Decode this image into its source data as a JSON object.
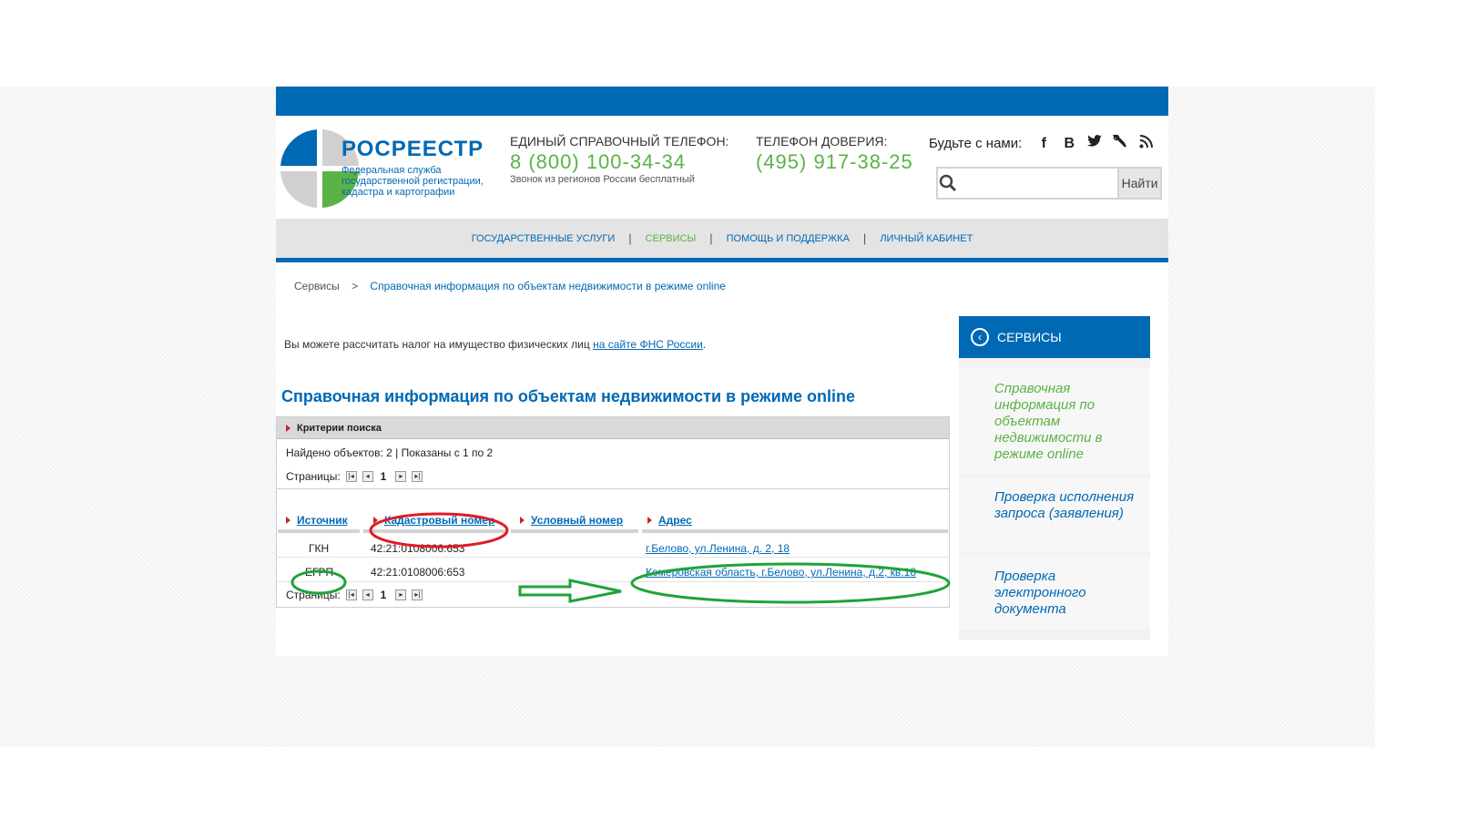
{
  "header": {
    "logo_title": "РОСРЕЕСТР",
    "logo_subtitle": "Федеральная служба государственной регистрации, кадастра и картографии",
    "phone1_label": "ЕДИНЫЙ СПРАВОЧНЫЙ ТЕЛЕФОН:",
    "phone1_number": "8 (800) 100-34-34",
    "phone1_note": "Звонок из регионов России бесплатный",
    "phone2_label": "ТЕЛЕФОН ДОВЕРИЯ:",
    "phone2_number": "(495) 917-38-25",
    "social_label": "Будьте с нами:",
    "social_icons": [
      "facebook-icon",
      "vk-icon",
      "twitter-icon",
      "livejournal-icon",
      "rss-icon"
    ],
    "search_placeholder": "",
    "search_button": "Найти"
  },
  "nav": {
    "items": [
      {
        "label": "ГОСУДАРСТВЕННЫЕ УСЛУГИ"
      },
      {
        "label": "СЕРВИСЫ"
      },
      {
        "label": "ПОМОЩЬ И ПОДДЕРЖКА"
      },
      {
        "label": "ЛИЧНЫЙ КАБИНЕТ"
      }
    ]
  },
  "breadcrumb": {
    "root": "Сервисы",
    "separator": ">",
    "current": "Справочная информация по объектам недвижимости в режиме online"
  },
  "tax_note": {
    "text": "Вы можете рассчитать налог на имущество физических лиц ",
    "link": "на сайте ФНС России",
    "tail": "."
  },
  "main": {
    "title": "Справочная информация по объектам недвижимости в режиме online"
  },
  "results": {
    "criteria_label": "Критерии поиска",
    "found_text": "Найдено объектов: 2 | Показаны с 1 по 2",
    "pages_label": "Страницы:",
    "current_page": "1",
    "pager_icons": [
      "first-page-icon",
      "prev-page-icon",
      "next-page-icon",
      "last-page-icon"
    ],
    "columns": [
      "Источник",
      "Кадастровый номер",
      "Условный номер",
      "Адрес"
    ],
    "rows": [
      {
        "source": "ГКН",
        "cadastral": "42:21:0108006:653",
        "conditional": "",
        "address": "г.Белово, ул.Ленина, д. 2, 18"
      },
      {
        "source": "ЕГРП",
        "cadastral": "42:21:0108006:653",
        "conditional": "",
        "address": "Кемеровская область, г.Белово, ул.Ленина, д.2, кв.18"
      }
    ]
  },
  "sidebar": {
    "title": "СЕРВИСЫ",
    "items": [
      {
        "label": "Справочная информация по объектам недвижимости в режиме online"
      },
      {
        "label": "Проверка исполнения запроса (заявления)"
      },
      {
        "label": "Проверка электронного документа"
      }
    ]
  },
  "colors": {
    "brand_blue": "#0069b4",
    "brand_green": "#5bb246",
    "annotation_red": "#e01b24",
    "annotation_green": "#1fa33a"
  }
}
